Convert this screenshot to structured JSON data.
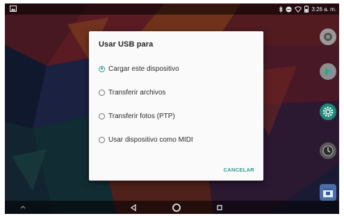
{
  "status_bar": {
    "time": "3:26 a. m.",
    "icons": [
      "screenshot-icon",
      "bluetooth-icon",
      "do-not-disturb-icon",
      "wifi-icon",
      "battery-icon"
    ]
  },
  "dialog": {
    "title": "Usar USB para",
    "options": [
      {
        "label": "Cargar este dispositivo",
        "selected": true
      },
      {
        "label": "Transferir archivos",
        "selected": false
      },
      {
        "label": "Transferir fotos (PTP)",
        "selected": false
      },
      {
        "label": "Usar dispositivo como MIDI",
        "selected": false
      }
    ],
    "cancel_label": "CANCELAR"
  },
  "dock_apps": [
    "camera-app-icon",
    "play-store-icon",
    "settings-app-icon",
    "clock-app-icon",
    "calendar-app-icon"
  ],
  "nav_bar": [
    "back-icon",
    "home-icon",
    "recents-icon"
  ],
  "colors": {
    "accent": "#2a9b8a",
    "dialog_bg": "#fafafa",
    "scrim": "rgba(0,0,0,0.42)"
  }
}
